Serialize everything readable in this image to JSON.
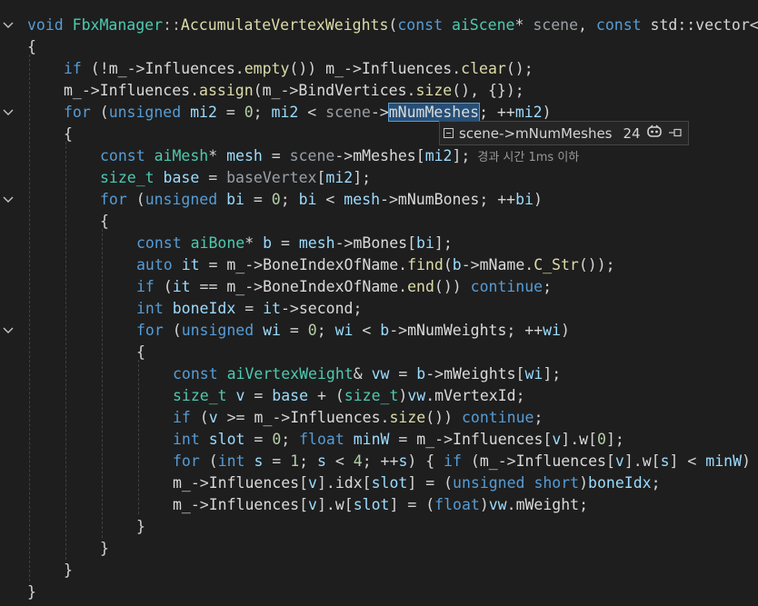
{
  "code": {
    "l1": {
      "a": "void",
      "b": " FbxManager",
      "c": "::",
      "d": "AccumulateVertexWeights",
      "e": "(",
      "f": "const",
      "g": " ",
      "h": "aiScene",
      "i": "* ",
      "j": "scene",
      "k": ", ",
      "l": "const",
      "m": " std::vector<"
    },
    "l2": {
      "a": "{"
    },
    "l3": {
      "a": "if",
      "b": " (!",
      "c": "m_",
      "d": "->",
      "e": "Influences",
      "f": ".",
      "g": "empty",
      "h": "()) ",
      "i": "m_",
      "j": "->",
      "k": "Influences",
      "l": ".",
      "m": "clear",
      "n": "();"
    },
    "l4": {
      "a": "m_",
      "b": "->",
      "c": "Influences",
      "d": ".",
      "e": "assign",
      "f": "(",
      "g": "m_",
      "h": "->",
      "i": "BindVertices",
      "j": ".",
      "k": "size",
      "l": "(), {});"
    },
    "l5": {
      "a": "for",
      "b": " (",
      "c": "unsigned",
      "d": " ",
      "e": "mi2",
      "f": " = ",
      "g": "0",
      "h": "; ",
      "i": "mi2",
      "j": " < ",
      "k": "scene",
      "l": "->",
      "m": "mNumMeshes",
      "n": "; ++",
      "o": "mi2",
      "p": ")"
    },
    "l6": {
      "a": "{"
    },
    "l7": {
      "a": "const",
      "b": " ",
      "c": "aiMesh",
      "d": "* ",
      "e": "mesh",
      "f": " = ",
      "g": "scene",
      "h": "->",
      "i": "mMeshes",
      "j": "[",
      "k": "mi2",
      "l": "];",
      "m": "경과 시간 1ms 이하"
    },
    "l8": {
      "a": "size_t",
      "b": " ",
      "c": "base",
      "d": " = ",
      "e": "baseVertex",
      "f": "[",
      "g": "mi2",
      "h": "];"
    },
    "l9": {
      "a": "for",
      "b": " (",
      "c": "unsigned",
      "d": " ",
      "e": "bi",
      "f": " = ",
      "g": "0",
      "h": "; ",
      "i": "bi",
      "j": " < ",
      "k": "mesh",
      "l": "->",
      "m": "mNumBones",
      "n": "; ++",
      "o": "bi",
      "p": ")"
    },
    "l10": {
      "a": "{"
    },
    "l11": {
      "a": "const",
      "b": " ",
      "c": "aiBone",
      "d": "* ",
      "e": "b",
      "f": " = ",
      "g": "mesh",
      "h": "->",
      "i": "mBones",
      "j": "[",
      "k": "bi",
      "l": "];"
    },
    "l12": {
      "a": "auto",
      "b": " ",
      "c": "it",
      "d": " = ",
      "e": "m_",
      "f": "->",
      "g": "BoneIndexOfName",
      "h": ".",
      "i": "find",
      "j": "(",
      "k": "b",
      "l": "->",
      "m": "mName",
      "n": ".",
      "o": "C_Str",
      "p": "());"
    },
    "l13": {
      "a": "if",
      "b": " (",
      "c": "it",
      "d": " == ",
      "e": "m_",
      "f": "->",
      "g": "BoneIndexOfName",
      "h": ".",
      "i": "end",
      "j": "()) ",
      "k": "continue",
      "l": ";"
    },
    "l14": {
      "a": "int",
      "b": " ",
      "c": "boneIdx",
      "d": " = ",
      "e": "it",
      "f": "->",
      "g": "second",
      "h": ";"
    },
    "l15": {
      "a": "for",
      "b": " (",
      "c": "unsigned",
      "d": " ",
      "e": "wi",
      "f": " = ",
      "g": "0",
      "h": "; ",
      "i": "wi",
      "j": " < ",
      "k": "b",
      "l": "->",
      "m": "mNumWeights",
      "n": "; ++",
      "o": "wi",
      "p": ")"
    },
    "l16": {
      "a": "{"
    },
    "l17": {
      "a": "const",
      "b": " ",
      "c": "aiVertexWeight",
      "d": "& ",
      "e": "vw",
      "f": " = ",
      "g": "b",
      "h": "->",
      "i": "mWeights",
      "j": "[",
      "k": "wi",
      "l": "];"
    },
    "l18": {
      "a": "size_t",
      "b": " ",
      "c": "v",
      "d": " = ",
      "e": "base",
      "f": " + (",
      "g": "size_t",
      "h": ")",
      "i": "vw",
      "j": ".",
      "k": "mVertexId",
      "l": ";"
    },
    "l19": {
      "a": "if",
      "b": " (",
      "c": "v",
      "d": " >= ",
      "e": "m_",
      "f": "->",
      "g": "Influences",
      "h": ".",
      "i": "size",
      "j": "()) ",
      "k": "continue",
      "l": ";"
    },
    "l20": {
      "a": "int",
      "b": " ",
      "c": "slot",
      "d": " = ",
      "e": "0",
      "f": "; ",
      "g": "float",
      "h": " ",
      "i": "minW",
      "j": " = ",
      "k": "m_",
      "l": "->",
      "m": "Influences",
      "n": "[",
      "o": "v",
      "p": "].",
      "q": "w",
      "r": "[",
      "s": "0",
      "t": "];"
    },
    "l21": {
      "a": "for",
      "b": " (",
      "c": "int",
      "d": " ",
      "e": "s",
      "f": " = ",
      "g": "1",
      "h": "; ",
      "i": "s",
      "j": " < ",
      "k": "4",
      "l": "; ++",
      "m": "s",
      "n": ") { ",
      "o": "if",
      "p": " (",
      "q": "m_",
      "r": "->",
      "s": "Influences",
      "t": "[",
      "u": "v",
      "v": "].",
      "w": "w",
      "x": "[",
      "y": "s",
      "z": "] < ",
      "za": "minW",
      "zb": ")"
    },
    "l22": {
      "a": "m_",
      "b": "->",
      "c": "Influences",
      "d": "[",
      "e": "v",
      "f": "].",
      "g": "idx",
      "h": "[",
      "i": "slot",
      "j": "] = (",
      "k": "unsigned",
      "l": " ",
      "m": "short",
      "n": ")",
      "o": "boneIdx",
      "p": ";"
    },
    "l23": {
      "a": "m_",
      "b": "->",
      "c": "Influences",
      "d": "[",
      "e": "v",
      "f": "].",
      "g": "w",
      "h": "[",
      "i": "slot",
      "j": "] = (",
      "k": "float",
      "l": ")",
      "m": "vw",
      "n": ".",
      "o": "mWeight",
      "p": ";"
    },
    "l24": {
      "a": "}"
    },
    "l25": {
      "a": "}"
    },
    "l26": {
      "a": "}"
    },
    "l27": {
      "a": "}"
    }
  },
  "tooltip": {
    "expression": "scene->mNumMeshes",
    "value": "24",
    "icon": "copilot-icon",
    "pin_icon": "pin-icon"
  },
  "colors": {
    "background": "#1e1e1e",
    "keyword": "#569cd6",
    "type": "#4ec9b0",
    "function": "#dcdcaa",
    "variable": "#9cdcfe",
    "number": "#b5cea8",
    "selection": "#264f78"
  }
}
